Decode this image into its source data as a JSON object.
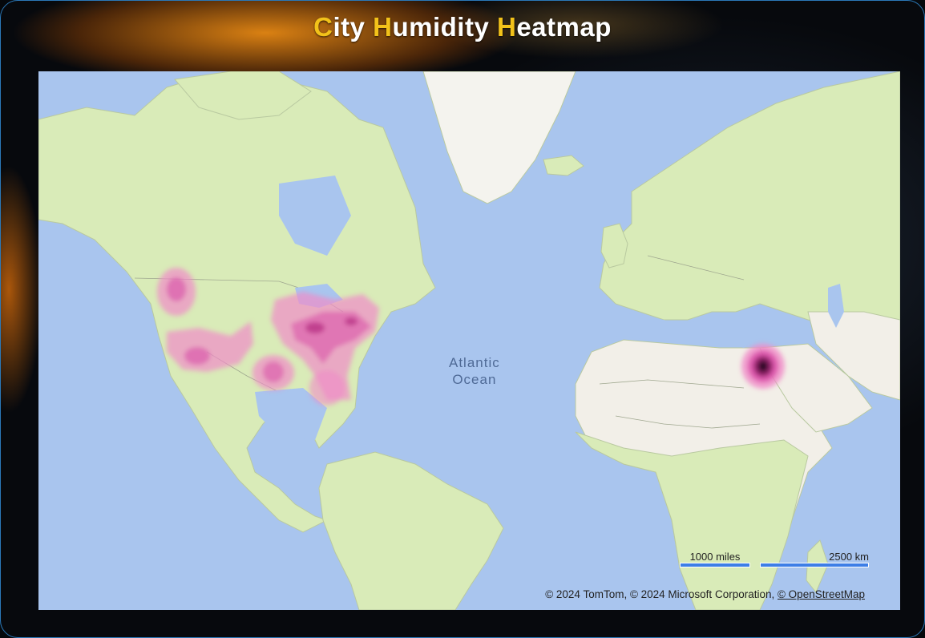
{
  "title": {
    "parts": [
      {
        "text": "C",
        "highlight": true
      },
      {
        "text": "ity ",
        "highlight": false
      },
      {
        "text": "H",
        "highlight": true
      },
      {
        "text": "umidity ",
        "highlight": false
      },
      {
        "text": "H",
        "highlight": true
      },
      {
        "text": "eatmap",
        "highlight": false
      }
    ],
    "highlight_color": "#f2c21a"
  },
  "map": {
    "ocean_label": {
      "line1": "Atlantic",
      "line2": "Ocean"
    },
    "scale": {
      "miles_label": "1000 miles",
      "km_label": "2500 km"
    },
    "attribution": {
      "text": "© 2024 TomTom, © 2024 Microsoft Corporation, ",
      "link": "© OpenStreetMap"
    },
    "colors": {
      "ocean": "#a9c5ee",
      "land": "#d9ebb8",
      "desert": "#f2efe8",
      "heat_low": "#f08cc8",
      "heat_high": "#2a0f24"
    }
  }
}
